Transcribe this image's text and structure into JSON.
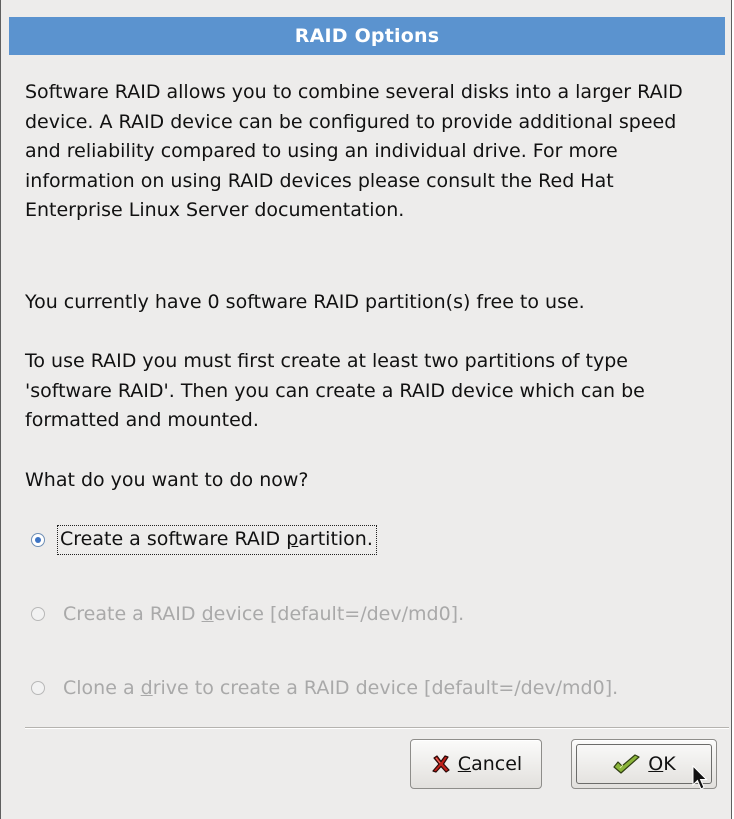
{
  "dialog": {
    "title": "RAID Options"
  },
  "body": {
    "paragraph1": "Software RAID allows you to combine several disks into a larger RAID device.  A RAID device can be configured to provide additional speed and reliability compared to using an individual drive.  For more information on using RAID devices please consult the Red Hat Enterprise Linux Server documentation.",
    "paragraph2": "You currently have 0 software RAID partition(s) free to use.",
    "paragraph3": "To use RAID you must first create at least two partitions of type 'software RAID'.  Then you can create a RAID device which can be formatted and mounted.",
    "question": "What do you want to do now?"
  },
  "options": [
    {
      "pre": "Create a software RAID ",
      "mnemonic": "p",
      "post": "artition.",
      "selected": true,
      "enabled": true
    },
    {
      "pre": "Create a RAID ",
      "mnemonic": "d",
      "post": "evice [default=/dev/md0].",
      "selected": false,
      "enabled": false
    },
    {
      "pre": "Clone a ",
      "mnemonic": "d",
      "post": "rive to create a RAID device [default=/dev/md0].",
      "selected": false,
      "enabled": false
    }
  ],
  "buttons": {
    "cancel": {
      "mnemonic": "C",
      "rest": "ancel",
      "icon": "cancel-x-icon"
    },
    "ok": {
      "mnemonic": "O",
      "rest": "K",
      "icon": "ok-check-icon"
    }
  },
  "colors": {
    "titlebar": "#5b93cf",
    "background": "#edeceb",
    "disabled_text": "#a9a9a9",
    "radio_selected": "#3d74c4"
  }
}
